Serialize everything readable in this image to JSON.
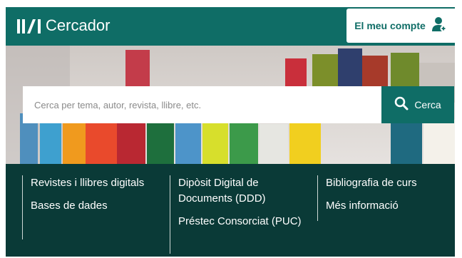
{
  "header": {
    "app_title": "Cercador",
    "account_label": "El meu compte",
    "logo_icon": "library-logo-icon",
    "account_icon": "user-icon"
  },
  "search": {
    "placeholder": "Cerca per tema, autor, revista, llibre, etc.",
    "button_label": "Cerca",
    "button_icon": "search-icon"
  },
  "links": {
    "col1": [
      "Revistes i llibres digitals",
      "Bases de dades"
    ],
    "col2": [
      "Dipòsit Digital de Documents (DDD)",
      "Préstec Consorciat (PUC)"
    ],
    "col3": [
      "Bibliografia de curs",
      "Més informació"
    ]
  },
  "colors": {
    "brand": "#0f6d66",
    "footer_overlay": "#0a3734",
    "text_on_brand": "#ffffff"
  }
}
